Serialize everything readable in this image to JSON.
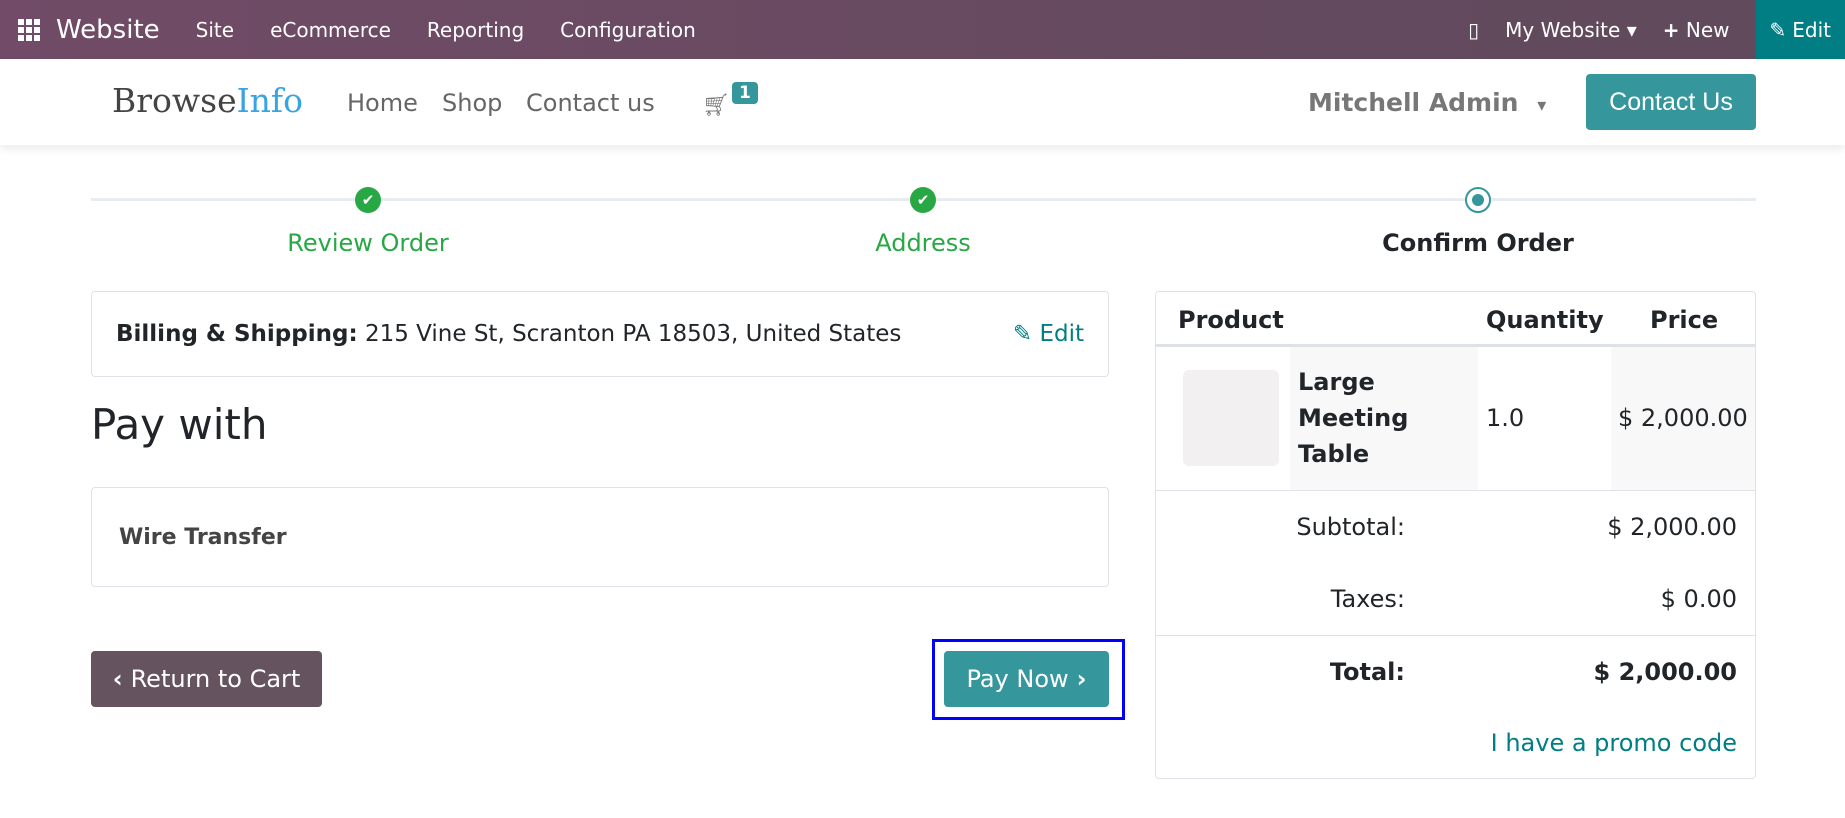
{
  "topbar": {
    "brand": "Website",
    "menus": [
      "Site",
      "eCommerce",
      "Reporting",
      "Configuration"
    ],
    "my_website": "My Website",
    "new": "New",
    "edit": "Edit"
  },
  "header": {
    "logo_a": "Browse",
    "logo_b": "Info",
    "nav": [
      "Home",
      "Shop",
      "Contact us"
    ],
    "cart_count": "1",
    "user": "Mitchell Admin",
    "contact_button": "Contact Us"
  },
  "steps": [
    {
      "label": "Review Order",
      "state": "done"
    },
    {
      "label": "Address",
      "state": "done"
    },
    {
      "label": "Confirm Order",
      "state": "current"
    }
  ],
  "billing": {
    "label": "Billing & Shipping:",
    "address": "215 Vine St, Scranton PA 18503, United States",
    "edit": "Edit"
  },
  "pay_with": {
    "title": "Pay with",
    "method": "Wire Transfer"
  },
  "buttons": {
    "return": "Return to Cart",
    "pay": "Pay Now"
  },
  "summary": {
    "headers": [
      "Product",
      "Quantity",
      "Price"
    ],
    "product": {
      "name": "Large Meeting Table",
      "quantity": "1.0",
      "price": "$ 2,000.00"
    },
    "subtotal_label": "Subtotal:",
    "subtotal": "$ 2,000.00",
    "taxes_label": "Taxes:",
    "taxes": "$ 0.00",
    "total_label": "Total:",
    "total": "$ 2,000.00",
    "promo": "I have a promo code"
  },
  "colors": {
    "primary": "#35979c",
    "odoo": "#714b67",
    "success": "#28a745",
    "highlight": "#0000ff"
  }
}
